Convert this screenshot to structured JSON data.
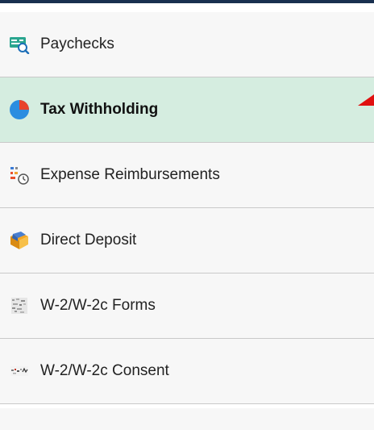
{
  "nav": {
    "items": [
      {
        "label": "Paychecks",
        "icon": "paycheck-icon",
        "selected": false
      },
      {
        "label": "Tax Withholding",
        "icon": "pie-chart-icon",
        "selected": true
      },
      {
        "label": "Expense Reimbursements",
        "icon": "expense-clock-icon",
        "selected": false
      },
      {
        "label": "Direct Deposit",
        "icon": "direct-deposit-icon",
        "selected": false
      },
      {
        "label": "W-2/W-2c Forms",
        "icon": "forms-icon",
        "selected": false
      },
      {
        "label": "W-2/W-2c Consent",
        "icon": "consent-icon",
        "selected": false
      }
    ]
  },
  "colors": {
    "top_bar": "#19304f",
    "selected_bg": "#d5ede0",
    "item_bg": "#f7f7f7",
    "divider": "#c9c9c9",
    "indicator": "#e01010"
  }
}
